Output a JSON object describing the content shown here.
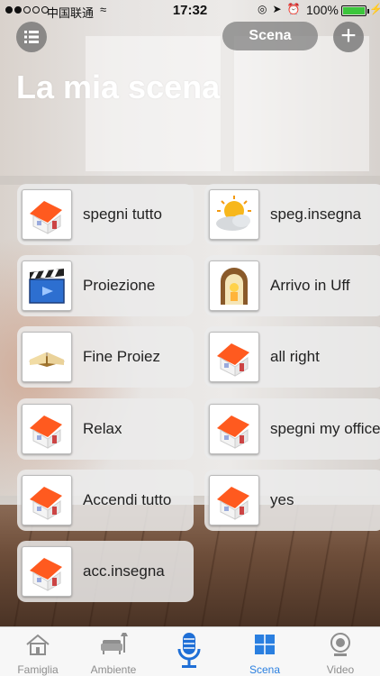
{
  "status_bar": {
    "carrier": "中国联通",
    "time": "17:32",
    "battery": "100%"
  },
  "header": {
    "scene_button": "Scena",
    "title": "La mia scena"
  },
  "scenes": [
    {
      "label": "spegni tutto",
      "icon": "house-icon"
    },
    {
      "label": "speg.insegna",
      "icon": "weather-sun-cloud-icon"
    },
    {
      "label": "Proiezione",
      "icon": "clapperboard-icon"
    },
    {
      "label": "Arrivo in Uff",
      "icon": "doorway-icon"
    },
    {
      "label": "Fine Proiez",
      "icon": "open-book-icon"
    },
    {
      "label": "all right",
      "icon": "house-icon"
    },
    {
      "label": "Relax",
      "icon": "house-icon"
    },
    {
      "label": "spegni my office",
      "icon": "house-icon"
    },
    {
      "label": "Accendi tutto",
      "icon": "house-icon"
    },
    {
      "label": "yes",
      "icon": "house-icon"
    },
    {
      "label": "acc.insegna",
      "icon": "house-icon"
    }
  ],
  "tabs": [
    {
      "label": "Famiglia",
      "icon": "home-icon",
      "active": false
    },
    {
      "label": "Ambiente",
      "icon": "sofa-icon",
      "active": false
    },
    {
      "label": "",
      "icon": "microphone-icon",
      "active": false
    },
    {
      "label": "Scena",
      "icon": "scene-grid-icon",
      "active": true
    },
    {
      "label": "Video",
      "icon": "camera-icon",
      "active": false
    }
  ],
  "colors": {
    "accent": "#2a7fe0",
    "tab_inactive": "#8e8e8e",
    "battery": "#3cc63c"
  }
}
